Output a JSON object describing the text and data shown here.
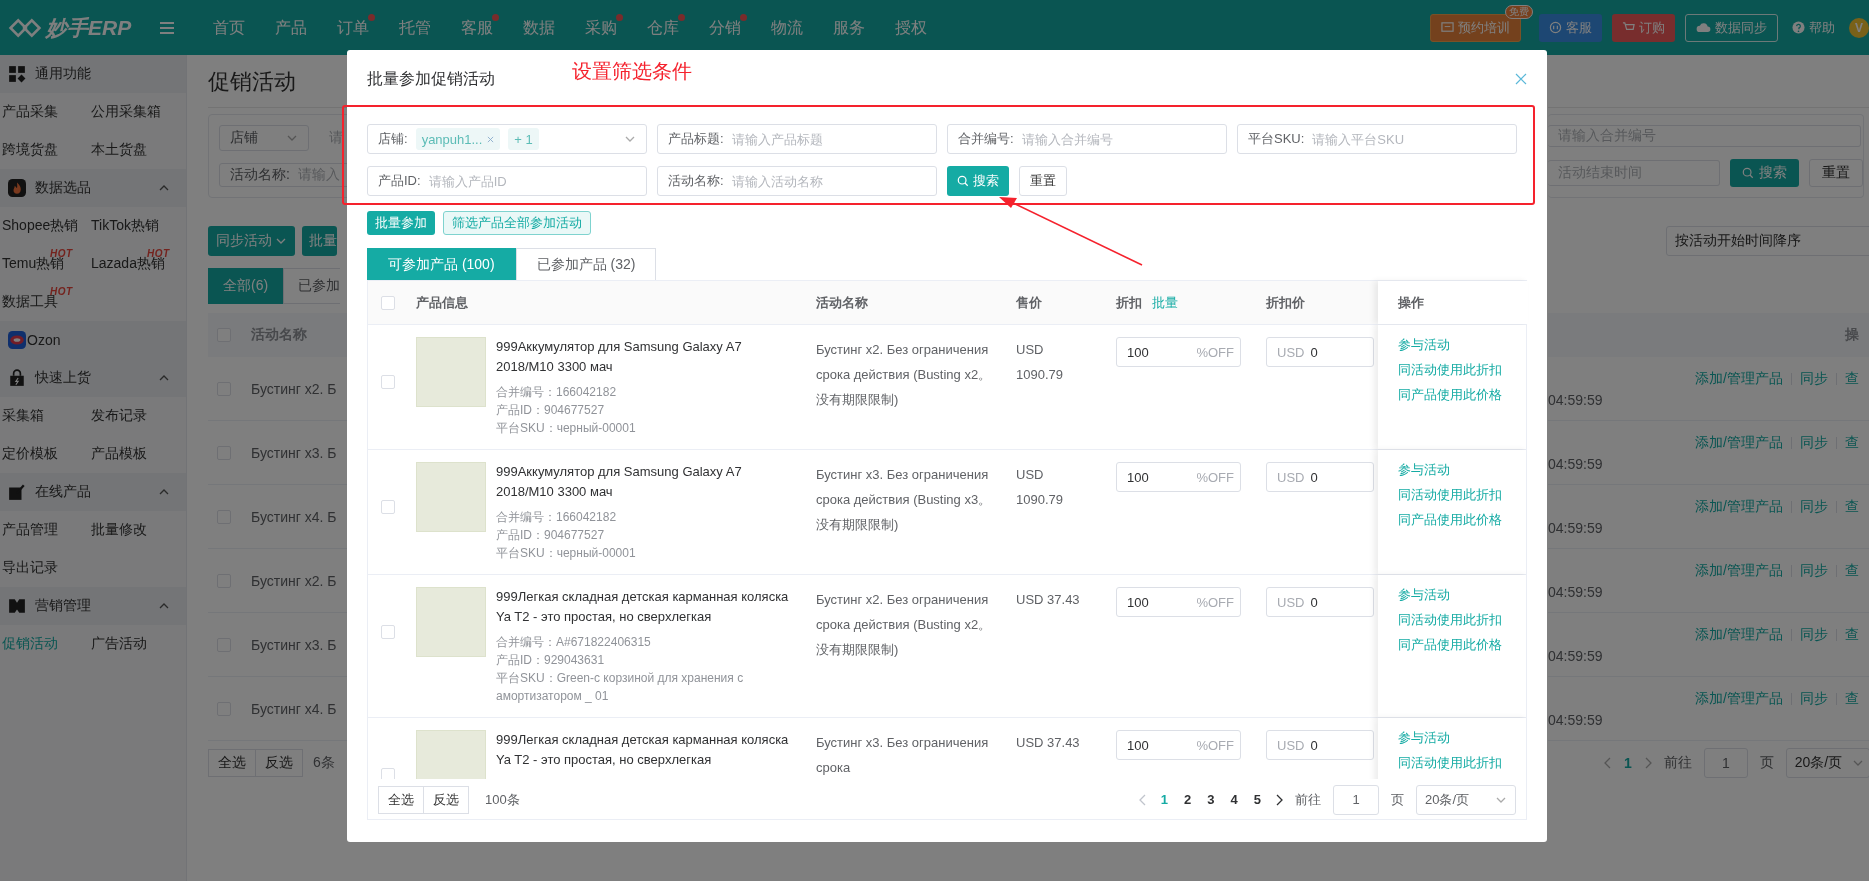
{
  "topbar": {
    "logo": "妙手ERP",
    "nav": [
      {
        "label": "首页",
        "dot": false
      },
      {
        "label": "产品",
        "dot": false
      },
      {
        "label": "订单",
        "dot": true
      },
      {
        "label": "托管",
        "dot": false
      },
      {
        "label": "客服",
        "dot": true
      },
      {
        "label": "数据",
        "dot": false
      },
      {
        "label": "采购",
        "dot": true
      },
      {
        "label": "仓库",
        "dot": true
      },
      {
        "label": "分销",
        "dot": true
      },
      {
        "label": "物流",
        "dot": false
      },
      {
        "label": "服务",
        "dot": false
      },
      {
        "label": "授权",
        "dot": false
      }
    ],
    "actions": [
      {
        "kind": "training",
        "label": "预约培训",
        "badge": "免费"
      },
      {
        "kind": "service",
        "label": "客服"
      },
      {
        "kind": "order",
        "label": "订购"
      },
      {
        "kind": "sync",
        "label": "数据同步"
      },
      {
        "kind": "help",
        "label": "帮助"
      }
    ],
    "avatar": "V"
  },
  "sidebar": {
    "sections": [
      {
        "title": "通用功能",
        "kind": "plain",
        "items": [
          {
            "label": "产品采集",
            "selected": false
          },
          {
            "label": "公用采集箱",
            "selected": false
          },
          {
            "label": "跨境货盘",
            "selected": false
          },
          {
            "label": "本土货盘",
            "selected": false
          }
        ]
      },
      {
        "title": "数据选品",
        "kind": "collapsible",
        "expanded": true,
        "items": [
          {
            "label": "Shopee热销",
            "selected": false
          },
          {
            "label": "TikTok热销",
            "selected": false
          },
          {
            "label": "Temu热销",
            "selected": false,
            "badge": "HOT"
          },
          {
            "label": "Lazada热销",
            "selected": false,
            "badge": "HOT"
          },
          {
            "label": "数据工具",
            "selected": false,
            "badge": "HOT"
          }
        ]
      },
      {
        "title": "Ozon",
        "kind": "plain"
      },
      {
        "title": "快速上货",
        "kind": "collapsible",
        "expanded": true,
        "items": [
          {
            "label": "采集箱",
            "selected": false
          },
          {
            "label": "发布记录",
            "selected": false
          },
          {
            "label": "定价模板",
            "selected": false
          },
          {
            "label": "产品模板",
            "selected": false
          }
        ]
      },
      {
        "title": "在线产品",
        "kind": "collapsible",
        "expanded": true,
        "items": [
          {
            "label": "产品管理",
            "selected": false
          },
          {
            "label": "批量修改",
            "selected": false
          },
          {
            "label": "导出记录",
            "selected": false
          }
        ]
      },
      {
        "title": "营销管理",
        "kind": "collapsible",
        "expanded": true,
        "items": [
          {
            "label": "促销活动",
            "selected": true
          },
          {
            "label": "广告活动",
            "selected": false
          }
        ]
      }
    ]
  },
  "page": {
    "title": "促销活动",
    "shop_select": "店铺",
    "shop_placeholder": "请",
    "activity_label": "活动名称:",
    "activity_placeholder": "请输入",
    "merge_placeholder": "请输入合并编号",
    "end_placeholder": "活动结束时间",
    "search": "搜索",
    "reset": "重置",
    "buttons": [
      "同步活动",
      "批量"
    ],
    "tabs": [
      {
        "label": "全部(6)",
        "selected": true
      },
      {
        "label": "已参加",
        "selected": false
      }
    ],
    "sort": "按活动开始时间降序",
    "columns": [
      "活动名称",
      "操"
    ],
    "all_checked": false,
    "rows": [
      {
        "name": "Бустинг x2. Б",
        "time": "04:59:59",
        "actions": [
          "添加/管理产品",
          "同步",
          "查"
        ],
        "checked": false
      },
      {
        "name": "Бустинг x3. Б",
        "time": "04:59:59",
        "actions": [
          "添加/管理产品",
          "同步",
          "查"
        ],
        "checked": false
      },
      {
        "name": "Бустинг x4. Б",
        "time": "04:59:59",
        "actions": [
          "添加/管理产品",
          "同步",
          "查"
        ],
        "checked": false
      },
      {
        "name": "Бустинг x2. Б",
        "time": "04:59:59",
        "actions": [
          "添加/管理产品",
          "同步",
          "查"
        ],
        "checked": false
      },
      {
        "name": "Бустинг x3. Б",
        "time": "04:59:59",
        "actions": [
          "添加/管理产品",
          "同步",
          "查"
        ],
        "checked": false
      },
      {
        "name": "Бустинг x4. Б",
        "time": "04:59:59",
        "actions": [
          "添加/管理产品",
          "同步",
          "查"
        ],
        "checked": false
      }
    ],
    "footer": {
      "buttons": [
        "全选",
        "反选"
      ],
      "count": "6条",
      "pages": [
        {
          "label": "1",
          "selected": true
        }
      ],
      "goto": "前往",
      "page_input": "1",
      "page_unit": "页",
      "page_size": "20条/页"
    }
  },
  "modal": {
    "title": "批量参加促销活动",
    "annotation": "设置筛选条件",
    "filters": [
      {
        "kind": "tags",
        "label": "店铺:",
        "tags": [
          "yanpuh1..."
        ],
        "more": "+ 1"
      },
      {
        "kind": "text",
        "label": "产品标题:",
        "placeholder": "请输入产品标题"
      },
      {
        "kind": "text",
        "label": "合并编号:",
        "placeholder": "请输入合并编号"
      },
      {
        "kind": "text",
        "label": "平台SKU:",
        "placeholder": "请输入平台SKU"
      },
      {
        "kind": "text",
        "label": "产品ID:",
        "placeholder": "请输入产品ID"
      },
      {
        "kind": "text",
        "label": "活动名称:",
        "placeholder": "请输入活动名称"
      }
    ],
    "search": "搜索",
    "reset": "重置",
    "actions": [
      {
        "kind": "primary",
        "label": "批量参加"
      },
      {
        "kind": "outline",
        "label": "筛选产品全部参加活动"
      }
    ],
    "tabs": [
      {
        "label": "可参加产品 (100)",
        "selected": true
      },
      {
        "label": "已参加产品 (32)",
        "selected": false
      }
    ],
    "columns": [
      "产品信息",
      "活动名称",
      "售价",
      "折扣",
      "折扣价",
      "操作"
    ],
    "batch_link": "批量",
    "all_checked": false,
    "rows": [
      {
        "checked": false,
        "title": "999Аккумулятор для Samsung Galaxy A7 2018/M10 3300 мач",
        "meta": [
          "合并编号：166042182",
          "产品ID：904677527",
          "平台SKU：черный-00001"
        ],
        "activity": "Бустинг x2. Без ограничения срока действия (Busting x2。没有期限限制)",
        "price": "USD 1090.79",
        "discount": "100",
        "discount_unit": "%OFF",
        "currency": "USD",
        "discount_price": "0",
        "actions": [
          "参与活动",
          "同活动使用此折扣",
          "同产品使用此价格"
        ]
      },
      {
        "checked": false,
        "title": "999Аккумулятор для Samsung Galaxy A7 2018/M10 3300 мач",
        "meta": [
          "合并编号：166042182",
          "产品ID：904677527",
          "平台SKU：черный-00001"
        ],
        "activity": "Бустинг x3. Без ограничения срока действия (Busting x3。没有期限限制)",
        "price": "USD 1090.79",
        "discount": "100",
        "discount_unit": "%OFF",
        "currency": "USD",
        "discount_price": "0",
        "actions": [
          "参与活动",
          "同活动使用此折扣",
          "同产品使用此价格"
        ]
      },
      {
        "checked": false,
        "title": "999Легкая складная детская карманная коляска Ya T2 - это простая, но сверхлегкая",
        "meta": [
          "合并编号：A#671822406315",
          "产品ID：929043631",
          "平台SKU：Green-с корзиной для хранения с амортизатором _ 01"
        ],
        "activity": "Бустинг x2. Без ограничения срока действия (Busting x2。没有期限限制)",
        "price": "USD 37.43",
        "discount": "100",
        "discount_unit": "%OFF",
        "currency": "USD",
        "discount_price": "0",
        "actions": [
          "参与活动",
          "同活动使用此折扣",
          "同产品使用此价格"
        ]
      },
      {
        "checked": false,
        "title": "999Легкая складная детская карманная коляска Ya T2 - это простая, но сверхлегкая",
        "activity": "Бустинг x3. Без ограничения срока",
        "price": "USD 37.43",
        "discount": "100",
        "discount_unit": "%OFF",
        "currency": "USD",
        "discount_price": "0",
        "actions": [
          "参与活动",
          "同活动使用此折扣"
        ]
      }
    ],
    "footer": {
      "buttons": [
        "全选",
        "反选"
      ],
      "count": "100条",
      "pages": [
        {
          "label": "1",
          "selected": true
        },
        {
          "label": "2",
          "selected": false
        },
        {
          "label": "3",
          "selected": false
        },
        {
          "label": "4",
          "selected": false
        },
        {
          "label": "5",
          "selected": false
        }
      ],
      "goto": "前往",
      "page_input": "1",
      "page_unit": "页",
      "page_size": "20条/页"
    }
  }
}
